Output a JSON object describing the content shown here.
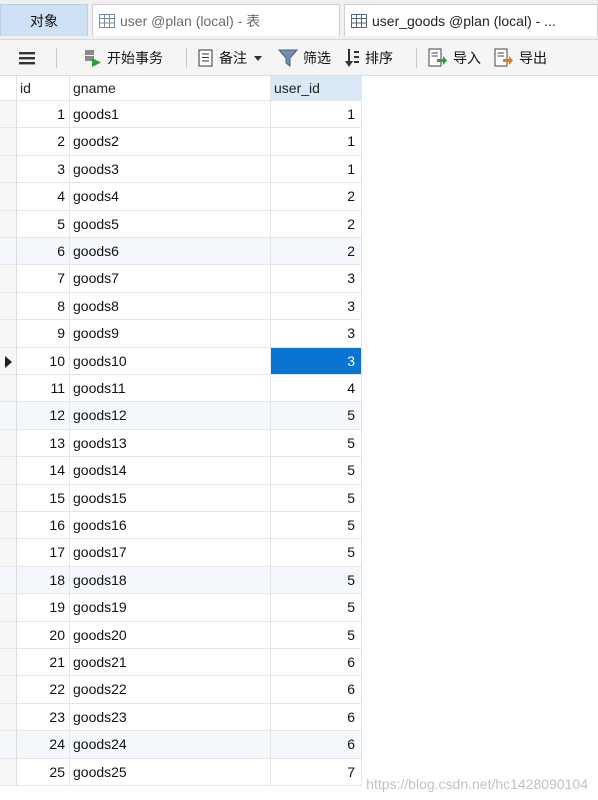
{
  "tabs": [
    {
      "label": "对象"
    },
    {
      "label": "user @plan (local) - 表"
    },
    {
      "label": "user_goods @plan (local) - ..."
    }
  ],
  "toolbar": {
    "begin_transaction": "开始事务",
    "note": "备注",
    "filter": "筛选",
    "sort": "排序",
    "import": "导入",
    "export": "导出"
  },
  "table": {
    "columns": [
      "id",
      "gname",
      "user_id"
    ],
    "selected_column": "user_id",
    "current_row_index": 9,
    "rows": [
      {
        "id": "1",
        "gname": "goods1",
        "user_id": "1"
      },
      {
        "id": "2",
        "gname": "goods2",
        "user_id": "1"
      },
      {
        "id": "3",
        "gname": "goods3",
        "user_id": "1"
      },
      {
        "id": "4",
        "gname": "goods4",
        "user_id": "2"
      },
      {
        "id": "5",
        "gname": "goods5",
        "user_id": "2"
      },
      {
        "id": "6",
        "gname": "goods6",
        "user_id": "2"
      },
      {
        "id": "7",
        "gname": "goods7",
        "user_id": "3"
      },
      {
        "id": "8",
        "gname": "goods8",
        "user_id": "3"
      },
      {
        "id": "9",
        "gname": "goods9",
        "user_id": "3"
      },
      {
        "id": "10",
        "gname": "goods10",
        "user_id": "3"
      },
      {
        "id": "11",
        "gname": "goods11",
        "user_id": "4"
      },
      {
        "id": "12",
        "gname": "goods12",
        "user_id": "5"
      },
      {
        "id": "13",
        "gname": "goods13",
        "user_id": "5"
      },
      {
        "id": "14",
        "gname": "goods14",
        "user_id": "5"
      },
      {
        "id": "15",
        "gname": "goods15",
        "user_id": "5"
      },
      {
        "id": "16",
        "gname": "goods16",
        "user_id": "5"
      },
      {
        "id": "17",
        "gname": "goods17",
        "user_id": "5"
      },
      {
        "id": "18",
        "gname": "goods18",
        "user_id": "5"
      },
      {
        "id": "19",
        "gname": "goods19",
        "user_id": "5"
      },
      {
        "id": "20",
        "gname": "goods20",
        "user_id": "5"
      },
      {
        "id": "21",
        "gname": "goods21",
        "user_id": "6"
      },
      {
        "id": "22",
        "gname": "goods22",
        "user_id": "6"
      },
      {
        "id": "23",
        "gname": "goods23",
        "user_id": "6"
      },
      {
        "id": "24",
        "gname": "goods24",
        "user_id": "6"
      },
      {
        "id": "25",
        "gname": "goods25",
        "user_id": "7"
      }
    ]
  },
  "watermark": "https://blog.csdn.net/hc1428090104",
  "colors": {
    "selected_cell": "#0a74d2",
    "objects_tab": "#cfe2f5",
    "header_selected": "#dbe9f7"
  }
}
